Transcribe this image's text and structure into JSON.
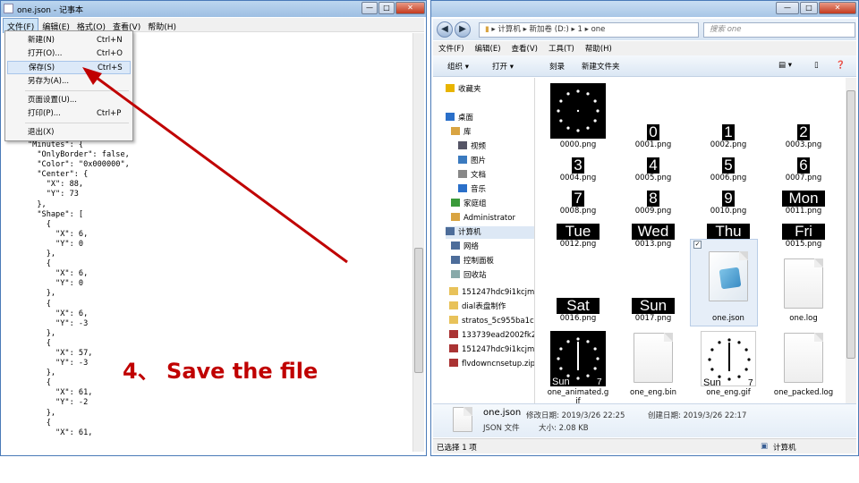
{
  "notepad": {
    "title": "one.json - 记事本",
    "controls": [
      "—",
      "□",
      "✕"
    ],
    "menu": [
      "文件(F)",
      "编辑(E)",
      "格式(O)",
      "查看(V)",
      "帮助(H)"
    ],
    "file_menu": [
      {
        "label": "新建(N)",
        "shortcut": "Ctrl+N"
      },
      {
        "label": "打开(O)...",
        "shortcut": "Ctrl+O"
      },
      {
        "label": "保存(S)",
        "shortcut": "Ctrl+S"
      },
      {
        "label": "另存为(A)...",
        "shortcut": ""
      },
      {
        "label": "页面设置(U)...",
        "shortcut": ""
      },
      {
        "label": "打印(P)...",
        "shortcut": "Ctrl+P"
      },
      {
        "label": "退出(X)",
        "shortcut": ""
      }
    ],
    "code": "\"Minutes\": {\n  \"OnlyBorder\": false,\n  \"Color\": \"0x000000\",\n  \"Center\": {\n    \"X\": 88,\n    \"Y\": 73\n  },\n  \"Shape\": [\n    {\n      \"X\": 6,\n      \"Y\": 0\n    },\n    {\n      \"X\": 6,\n      \"Y\": 0\n    },\n    {\n      \"X\": 6,\n      \"Y\": -3\n    },\n    {\n      \"X\": 57,\n      \"Y\": -3\n    },\n    {\n      \"X\": 61,\n      \"Y\": -2\n    },\n    {\n      \"X\": 61,"
  },
  "annotation": "4、 Save the  file",
  "explorer": {
    "path": [
      "计算机",
      "新加卷 (D:)",
      "1",
      "one"
    ],
    "search_placeholder": "搜索 one",
    "menu": [
      "文件(F)",
      "编辑(E)",
      "查看(V)",
      "工具(T)",
      "帮助(H)"
    ],
    "toolbar": [
      "组织 ▾",
      "打开 ▾",
      "刻录",
      "新建文件夹"
    ],
    "nav": [
      {
        "label": "收藏夹",
        "icon": "star-icon",
        "color": "#e8b400"
      },
      {
        "label": "桌面",
        "icon": "desktop-icon",
        "color": "#2a6fc9"
      },
      {
        "label": "库",
        "icon": "library-icon",
        "color": "#d9a441"
      },
      {
        "label": "视频",
        "icon": "video-icon",
        "color": "#556"
      },
      {
        "label": "图片",
        "icon": "picture-icon",
        "color": "#3a7abf"
      },
      {
        "label": "文档",
        "icon": "document-icon",
        "color": "#888"
      },
      {
        "label": "音乐",
        "icon": "music-icon",
        "color": "#2a6fc9"
      },
      {
        "label": "家庭组",
        "icon": "homegroup-icon",
        "color": "#3a9a3a"
      },
      {
        "label": "Administrator",
        "icon": "user-icon",
        "color": "#d9a441"
      },
      {
        "label": "计算机",
        "icon": "computer-icon",
        "color": "#4d6d9a"
      },
      {
        "label": "网络",
        "icon": "network-icon",
        "color": "#4d6d9a"
      },
      {
        "label": "控制面板",
        "icon": "control-panel-icon",
        "color": "#4d6d9a"
      },
      {
        "label": "回收站",
        "icon": "recycle-bin-icon",
        "color": "#8aa"
      },
      {
        "label": "151247hdc9i1kcjm",
        "icon": "folder-icon",
        "color": "#e8c25a"
      },
      {
        "label": "dial表盘制作",
        "icon": "folder-icon",
        "color": "#e8c25a"
      },
      {
        "label": "stratos_5c955ba1c",
        "icon": "folder-icon",
        "color": "#e8c25a"
      },
      {
        "label": "133739ead2002fk2",
        "icon": "archive-icon",
        "color": "#a33"
      },
      {
        "label": "151247hdc9i1kcjm",
        "icon": "archive-icon",
        "color": "#a33"
      },
      {
        "label": "flvdowncnsetup.zip",
        "icon": "archive-icon",
        "color": "#a33"
      }
    ],
    "files": [
      {
        "name": "0000.png",
        "glyph": ""
      },
      {
        "name": "0001.png",
        "glyph": "0"
      },
      {
        "name": "0002.png",
        "glyph": "1"
      },
      {
        "name": "0003.png",
        "glyph": "2"
      },
      {
        "name": "0004.png",
        "glyph": "3"
      },
      {
        "name": "0005.png",
        "glyph": "4"
      },
      {
        "name": "0006.png",
        "glyph": "5"
      },
      {
        "name": "0007.png",
        "glyph": "6"
      },
      {
        "name": "0008.png",
        "glyph": "7"
      },
      {
        "name": "0009.png",
        "glyph": "8"
      },
      {
        "name": "0010.png",
        "glyph": "9"
      },
      {
        "name": "0011.png",
        "glyph": "Mon"
      },
      {
        "name": "0012.png",
        "glyph": "Tue"
      },
      {
        "name": "0013.png",
        "glyph": "Wed"
      },
      {
        "name": "0014.png",
        "glyph": "Thu"
      },
      {
        "name": "0015.png",
        "glyph": "Fri"
      },
      {
        "name": "0016.png",
        "glyph": "Sat"
      },
      {
        "name": "0017.png",
        "glyph": "Sun"
      },
      {
        "name": "one.json",
        "glyph": ""
      },
      {
        "name": "one.log",
        "glyph": ""
      },
      {
        "name": "one_animated.g\nif",
        "glyph": "Sun 7"
      },
      {
        "name": "one_eng.bin",
        "glyph": ""
      },
      {
        "name": "one_eng.gif",
        "glyph": "Sun 7"
      },
      {
        "name": "one_packed.log",
        "glyph": ""
      }
    ],
    "details": {
      "name": "one.json",
      "type": "JSON 文件",
      "modified": "修改日期: 2019/3/26 22:25",
      "created": "创建日期: 2019/3/26 22:17",
      "size": "大小: 2.08 KB"
    },
    "status_left": "已选择 1 项",
    "status_right": "计算机"
  },
  "colors": {
    "annotation": "#c00000",
    "selection": "#dce9f8"
  }
}
